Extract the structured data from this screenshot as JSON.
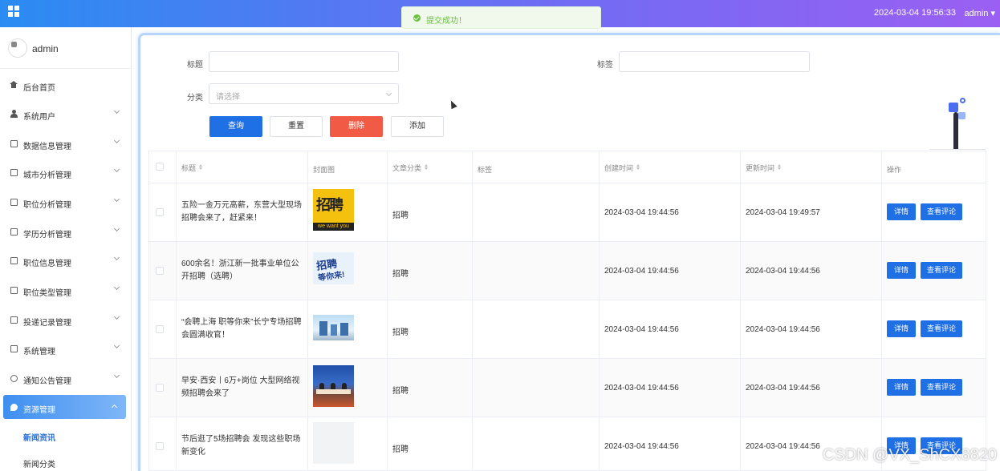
{
  "header": {
    "datetime": "2024-03-04 19:56:33",
    "user": "admin"
  },
  "toast": {
    "message": "提交成功！",
    "color": "#67c23a"
  },
  "sidebar": {
    "username": "admin",
    "items": [
      {
        "label": "后台首页",
        "icon": "home-icon"
      },
      {
        "label": "系统用户",
        "icon": "user-icon"
      },
      {
        "label": "数据信息管理",
        "icon": "folder-icon"
      },
      {
        "label": "城市分析管理",
        "icon": "folder-icon"
      },
      {
        "label": "职位分析管理",
        "icon": "folder-icon"
      },
      {
        "label": "学历分析管理",
        "icon": "folder-icon"
      },
      {
        "label": "职位信息管理",
        "icon": "folder-icon"
      },
      {
        "label": "职位类型管理",
        "icon": "folder-icon"
      },
      {
        "label": "投递记录管理",
        "icon": "folder-icon"
      },
      {
        "label": "系统管理",
        "icon": "image-icon"
      },
      {
        "label": "通知公告管理",
        "icon": "info-icon"
      },
      {
        "label": "资源管理",
        "icon": "location-icon"
      }
    ],
    "submenu": [
      {
        "label": "新闻资讯"
      },
      {
        "label": "新闻分类"
      }
    ]
  },
  "search": {
    "title_label": "标题",
    "title_value": "",
    "tag_label": "标签",
    "tag_value": "",
    "category_label": "分类",
    "category_placeholder": "请选择"
  },
  "buttons": {
    "query": "查询",
    "reset": "重置",
    "delete": "删除",
    "add": "添加"
  },
  "table": {
    "columns": [
      "标题",
      "封面图",
      "文章分类",
      "标签",
      "创建时间",
      "更新时间",
      "操作"
    ],
    "actions": {
      "detail": "详情",
      "comments": "查看评论"
    },
    "rows": [
      {
        "title": "五险一金万元高薪，东营大型现场招聘会来了，赶紧来！",
        "cover_text": "招聘 we want you",
        "category": "招聘",
        "tag": "",
        "created": "2024-03-04 19:44:56",
        "updated": "2024-03-04 19:49:57"
      },
      {
        "title": "600余名！浙江新一批事业单位公开招聘（选聘）",
        "cover_text": "招聘等你来！",
        "category": "招聘",
        "tag": "",
        "created": "2024-03-04 19:44:56",
        "updated": "2024-03-04 19:44:56"
      },
      {
        "title": "“会聘上海 职等你来”长宁专场招聘会圆满收官！",
        "cover_text": "",
        "category": "招聘",
        "tag": "",
        "created": "2024-03-04 19:44:56",
        "updated": "2024-03-04 19:44:56"
      },
      {
        "title": "早安·西安丨6万+岗位 大型网络视频招聘会来了",
        "cover_text": "",
        "category": "招聘",
        "tag": "",
        "created": "2024-03-04 19:44:56",
        "updated": "2024-03-04 19:44:56"
      },
      {
        "title": "节后逛了5场招聘会 发现这些职场新变化",
        "cover_text": "",
        "category": "招聘",
        "tag": "",
        "created": "2024-03-04 19:44:56",
        "updated": "2024-03-04 19:44:56"
      }
    ]
  },
  "watermark": "CSDN @VX_ShCX8820"
}
